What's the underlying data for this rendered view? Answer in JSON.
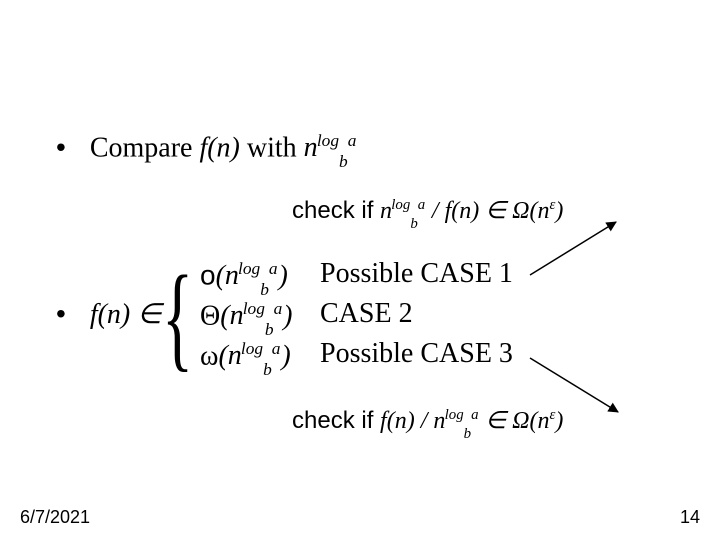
{
  "line1": {
    "bullet": "•",
    "pre": "Compare ",
    "fn": "f(n)",
    "mid": " with ",
    "n": "n",
    "logb": "log",
    "b": "b",
    "a": "a"
  },
  "check1": {
    "pre": "check if ",
    "n": "n",
    "logb": "log",
    "b": "b",
    "a": "a",
    "slash": " / ",
    "fn": "f(n)",
    "in": " ∈ ",
    "omega": "Ω(n",
    "eps": "ε",
    "close": ")"
  },
  "line2": {
    "bullet": "•",
    "fn": "f(n)",
    "in": " ∈ "
  },
  "cases": {
    "row1": {
      "sym": "o",
      "open": "(",
      "n": "n",
      "logb": "log",
      "b": "b",
      "a": "a",
      "close": ")",
      "label": "Possible CASE 1"
    },
    "row2": {
      "sym": "Θ",
      "open": "(",
      "n": "n",
      "logb": "log",
      "b": "b",
      "a": "a",
      "close": ")",
      "label": "CASE 2"
    },
    "row3": {
      "sym": "ω",
      "open": "(",
      "n": "n",
      "logb": "log",
      "b": "b",
      "a": "a",
      "close": ")",
      "label": "Possible CASE 3"
    }
  },
  "check2": {
    "pre": "check if ",
    "fn": "f(n)",
    "slash": " / ",
    "n": "n",
    "logb": "log",
    "b": "b",
    "a": "a",
    "in": " ∈ ",
    "omega": "Ω(n",
    "eps": "ε",
    "close": ")"
  },
  "footer": {
    "date": "6/7/2021",
    "page": "14"
  }
}
